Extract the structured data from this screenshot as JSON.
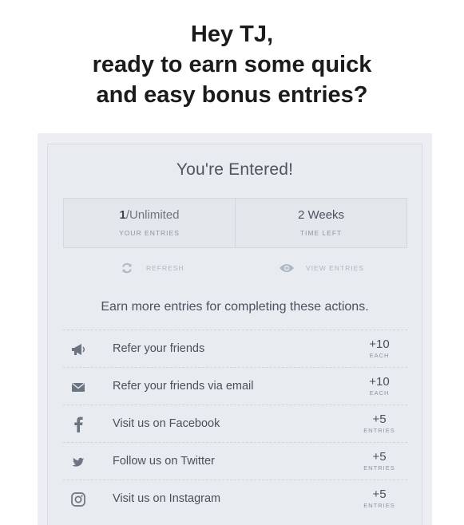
{
  "header": {
    "line1": "Hey TJ,",
    "line2": "ready to earn some quick",
    "line3": "and easy bonus entries?"
  },
  "widget": {
    "title": "You're Entered!",
    "stats": {
      "entries": {
        "count": "1",
        "separator": "/",
        "limit": "Unlimited",
        "label": "YOUR ENTRIES"
      },
      "time": {
        "value": "2 Weeks",
        "label": "TIME LEFT"
      }
    },
    "refresh_label": "REFRESH",
    "view_entries_label": "VIEW ENTRIES",
    "earn_title": "Earn more entries for completing these actions.",
    "actions": [
      {
        "icon": "megaphone-icon",
        "label": "Refer your friends",
        "points": "+10",
        "unit": "EACH"
      },
      {
        "icon": "envelope-icon",
        "label": "Refer your friends via email",
        "points": "+10",
        "unit": "EACH"
      },
      {
        "icon": "facebook-icon",
        "label": "Visit us on Facebook",
        "points": "+5",
        "unit": "ENTRIES"
      },
      {
        "icon": "twitter-icon",
        "label": "Follow us on Twitter",
        "points": "+5",
        "unit": "ENTRIES"
      },
      {
        "icon": "instagram-icon",
        "label": "Visit us on Instagram",
        "points": "+5",
        "unit": "ENTRIES"
      }
    ]
  },
  "colors": {
    "icon": "#6b7480",
    "muted_icon": "#aeb8c2",
    "card_bg": "#e8ebef"
  }
}
